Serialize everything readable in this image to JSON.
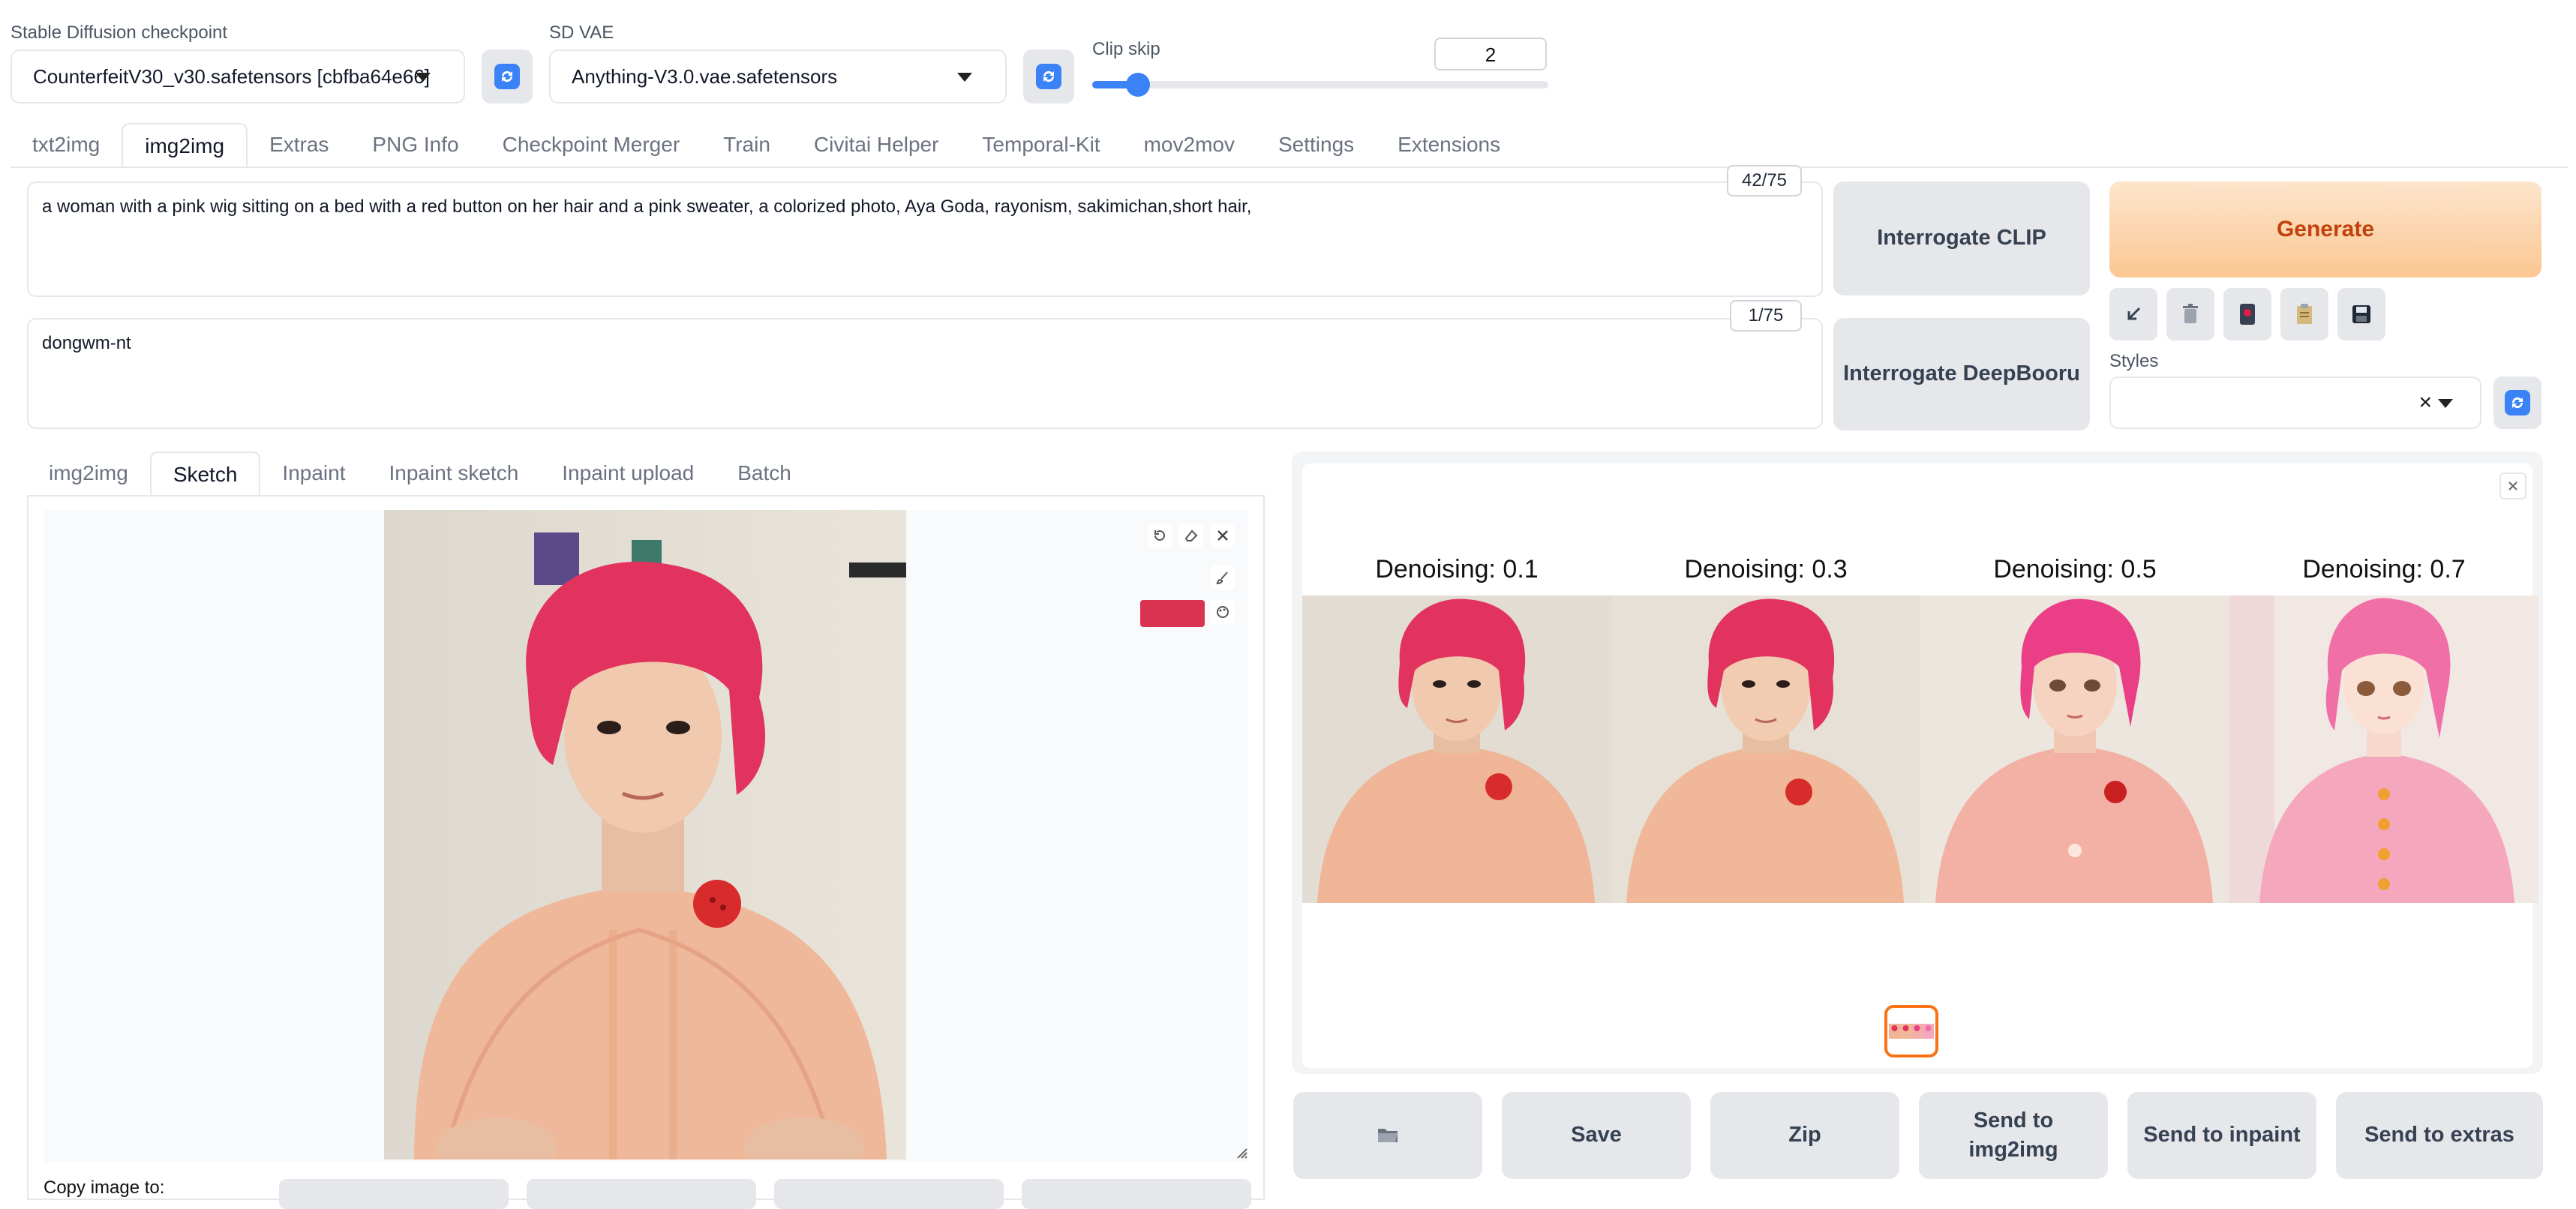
{
  "top": {
    "checkpoint_label": "Stable Diffusion checkpoint",
    "checkpoint_value": "CounterfeitV30_v30.safetensors [cbfba64e66]",
    "vae_label": "SD VAE",
    "vae_value": "Anything-V3.0.vae.safetensors",
    "clip_label": "Clip skip",
    "clip_value": "2",
    "clip_slider_fraction": 0.1
  },
  "main_tabs": [
    "txt2img",
    "img2img",
    "Extras",
    "PNG Info",
    "Checkpoint Merger",
    "Train",
    "Civitai Helper",
    "Temporal-Kit",
    "mov2mov",
    "Settings",
    "Extensions"
  ],
  "main_tab_active": "img2img",
  "prompt": {
    "text": "a woman with a pink wig sitting on a bed with a red button on her hair and a pink sweater, a colorized photo, Aya Goda, rayonism, sakimichan,short hair,",
    "counter": "42/75"
  },
  "negative": {
    "text": "dongwm-nt",
    "counter": "1/75"
  },
  "buttons": {
    "interrogate_clip": "Interrogate CLIP",
    "interrogate_deepbooru": "Interrogate DeepBooru",
    "generate": "Generate"
  },
  "styles": {
    "label": "Styles",
    "clear": "×"
  },
  "sub_tabs": [
    "img2img",
    "Sketch",
    "Inpaint",
    "Inpaint sketch",
    "Inpaint upload",
    "Batch"
  ],
  "sub_tab_active": "Sketch",
  "sketch": {
    "brush_color": "#d9344f",
    "copy_label": "Copy image to:"
  },
  "gallery": {
    "labels": [
      "Denoising: 0.1",
      "Denoising: 0.3",
      "Denoising: 0.5",
      "Denoising: 0.7"
    ]
  },
  "actions": {
    "save": "Save",
    "zip": "Zip",
    "send_img2img": "Send to img2img",
    "send_inpaint": "Send to inpaint",
    "send_extras": "Send to extras"
  },
  "colors": {
    "accent": "#f97316",
    "generate_bg": "#fbd1a6",
    "generate_text": "#c2410c",
    "wig": "#e2335f"
  }
}
